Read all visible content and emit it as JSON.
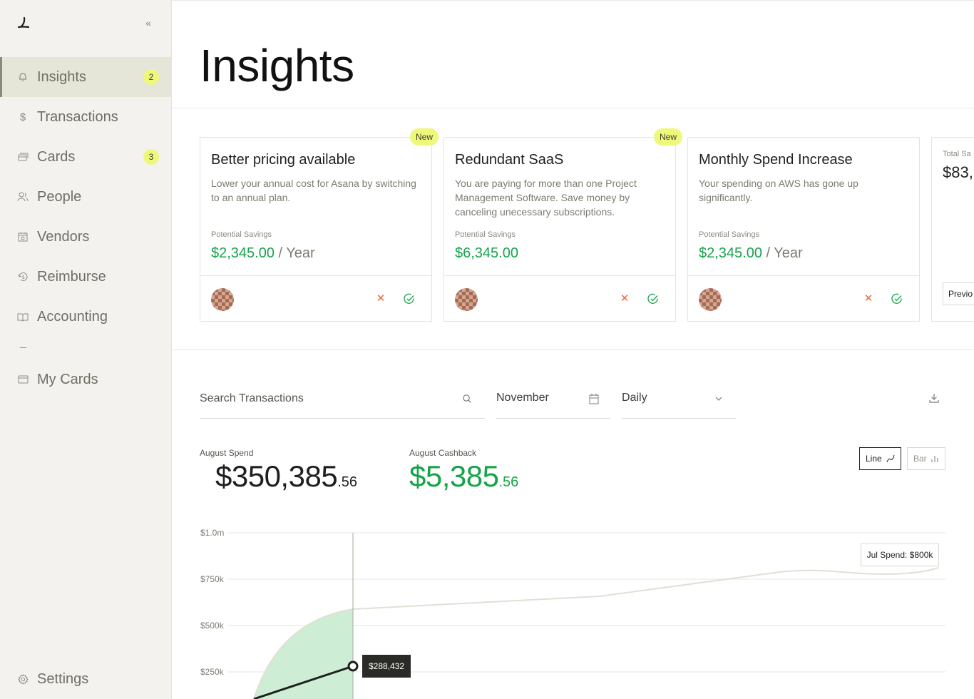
{
  "sidebar": {
    "collapse_glyph": "«",
    "items": [
      {
        "label": "Insights",
        "icon": "bell-icon",
        "badge": "2",
        "active": true
      },
      {
        "label": "Transactions",
        "icon": "dollar-icon"
      },
      {
        "label": "Cards",
        "icon": "cards-icon",
        "badge": "3"
      },
      {
        "label": "People",
        "icon": "people-icon"
      },
      {
        "label": "Vendors",
        "icon": "vendors-icon"
      },
      {
        "label": "Reimburse",
        "icon": "reimburse-icon"
      },
      {
        "label": "Accounting",
        "icon": "book-icon"
      },
      {
        "label": "My Cards",
        "icon": "card-icon"
      }
    ],
    "settings_label": "Settings"
  },
  "header": {
    "title": "Insights"
  },
  "insights": [
    {
      "title": "Better pricing available",
      "description": "Lower your annual cost for Asana by switching to an annual plan.",
      "savings_label": "Potential Savings",
      "savings_amount": "$2,345.00",
      "savings_unit": " / Year",
      "badge": "New"
    },
    {
      "title": "Redundant SaaS",
      "description": "You are paying for more than one Project Management Software. Save money by canceling unecessary subscriptions.",
      "savings_label": "Potential Savings",
      "savings_amount": "$6,345.00",
      "savings_unit": "",
      "badge": "New"
    },
    {
      "title": "Monthly Spend Increase",
      "description": "Your spending on AWS has gone up significantly.",
      "savings_label": "Potential Savings",
      "savings_amount": "$2,345.00",
      "savings_unit": " / Year",
      "badge": ""
    }
  ],
  "total_card": {
    "label": "Total Sa",
    "value": "$83,",
    "button": "Previo"
  },
  "filters": {
    "search_placeholder": "Search Transactions",
    "month": "November",
    "frequency": "Daily"
  },
  "stats": {
    "spend_label": "August Spend",
    "spend_main": "$350,385",
    "spend_cents": ".56",
    "cashback_label": "August Cashback",
    "cashback_main": "$5,385",
    "cashback_cents": ".56"
  },
  "chart_toggle": {
    "line_label": "Line",
    "bar_label": "Bar",
    "selected": "Line"
  },
  "colors": {
    "accent_green": "#16a34a",
    "badge_yellow": "#eef87a",
    "danger": "#f06a35"
  },
  "chart_data": {
    "type": "line",
    "y_ticks": [
      "$1.0m",
      "$750k",
      "$500k",
      "$250k"
    ],
    "ylim": [
      0,
      1000000
    ],
    "grid": true,
    "series": [],
    "callouts": {
      "right_label": "Jul Spend: $800k",
      "point_label": "$288,432",
      "point_value": 288432
    }
  }
}
